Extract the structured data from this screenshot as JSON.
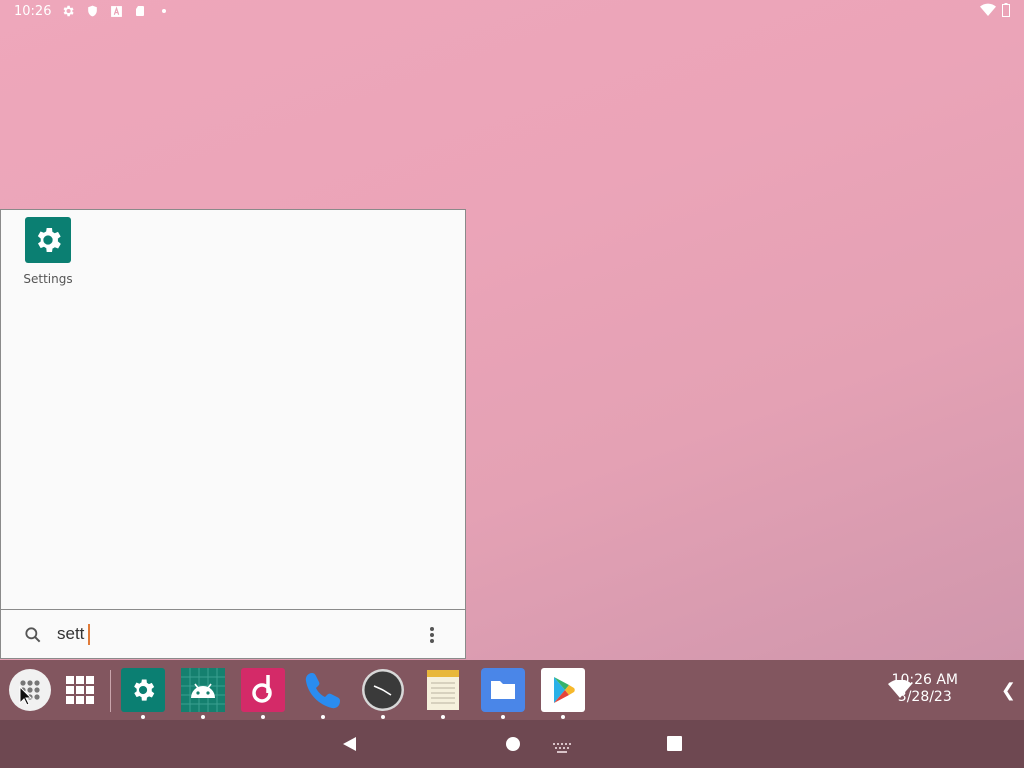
{
  "status_bar": {
    "time": "10:26",
    "icons": [
      "gear-icon",
      "shield-icon",
      "font-icon",
      "sd-card-icon",
      "dot-icon"
    ],
    "right_icons": [
      "wifi-icon",
      "battery-icon"
    ]
  },
  "drawer": {
    "apps": [
      {
        "label": "Settings",
        "icon": "settings-gear-icon"
      }
    ],
    "search": {
      "value": "sett",
      "icon": "magnifier-icon",
      "menu_icon": "more-vert-icon"
    }
  },
  "taskbar": {
    "apps": [
      "app-drawer",
      "overview-grid",
      "Settings",
      "Android",
      "Music",
      "Phone",
      "Clock",
      "Notes",
      "Files",
      "Play Store"
    ],
    "clock": {
      "time": "10:26 AM",
      "date": "3/28/23"
    },
    "chevron": "❮"
  },
  "navbar": {
    "buttons": [
      "back",
      "home",
      "keyboard",
      "recents"
    ]
  },
  "colors": {
    "taskbar": "#82565f",
    "navbar": "#6e4851",
    "settings_green": "#0b7f72",
    "caret": "#e07b39"
  }
}
